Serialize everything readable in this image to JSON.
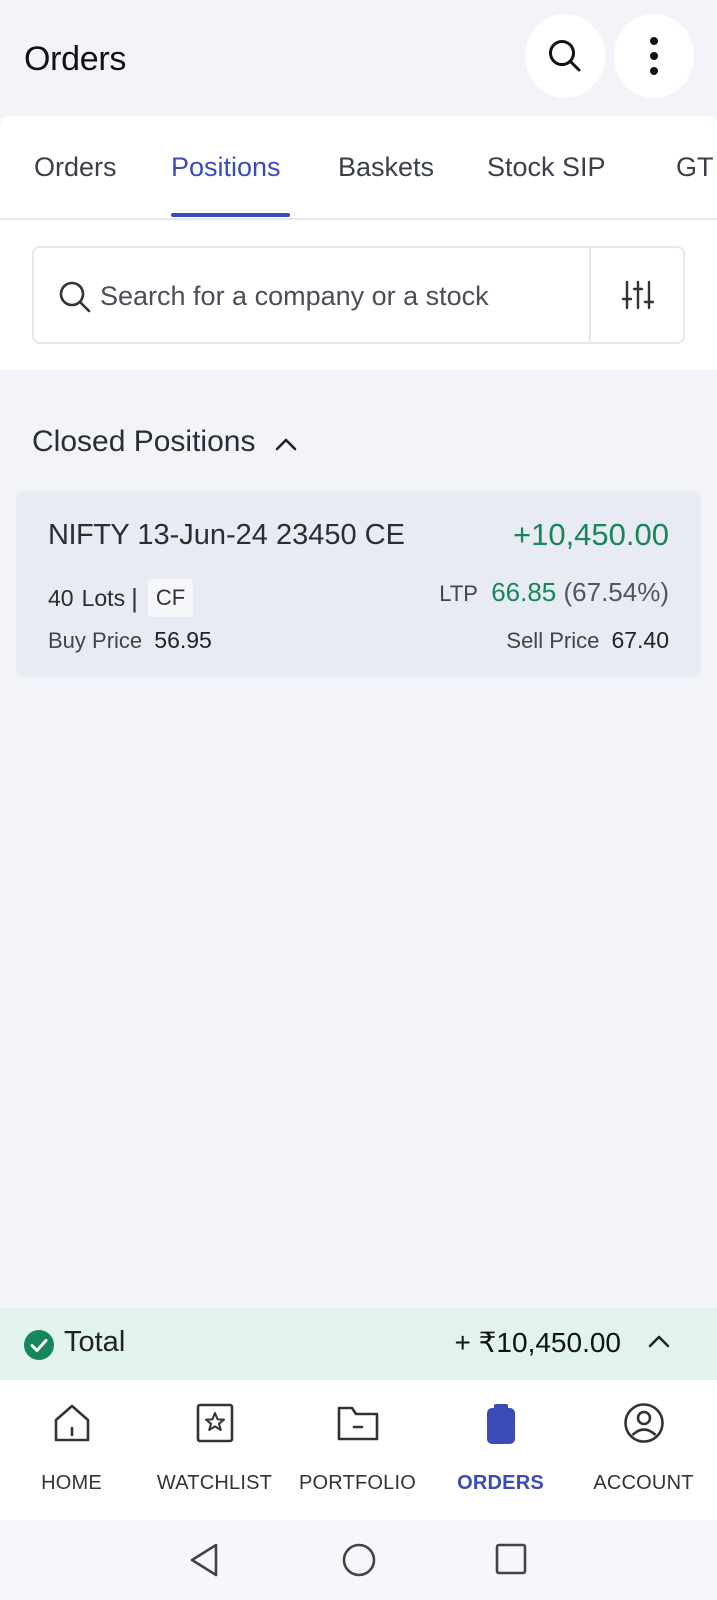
{
  "header": {
    "title": "Orders"
  },
  "tabs": [
    {
      "label": "Orders",
      "active": false
    },
    {
      "label": "Positions",
      "active": true
    },
    {
      "label": "Baskets",
      "active": false
    },
    {
      "label": "Stock SIP",
      "active": false
    },
    {
      "label": "GT",
      "active": false
    }
  ],
  "search": {
    "placeholder": "Search for a company or a stock"
  },
  "section": {
    "title": "Closed Positions"
  },
  "position": {
    "symbol": "NIFTY",
    "contract": "13-Jun-24 23450 CE",
    "pnl": "+10,450.00",
    "lots_qty": "40",
    "lots_label": "Lots",
    "lots_divider": "|",
    "product": "CF",
    "ltp_label": "LTP",
    "ltp_value": "66.85",
    "ltp_change": "(67.54%)",
    "buy_label": "Buy Price",
    "buy_value": "56.95",
    "sell_label": "Sell Price",
    "sell_value": "67.40"
  },
  "total": {
    "label": "Total",
    "value": "+ ₹10,450.00"
  },
  "bottom_nav": [
    {
      "label": "HOME",
      "icon": "home-icon",
      "active": false
    },
    {
      "label": "WATCHLIST",
      "icon": "watchlist-icon",
      "active": false
    },
    {
      "label": "PORTFOLIO",
      "icon": "portfolio-icon",
      "active": false
    },
    {
      "label": "ORDERS",
      "icon": "orders-icon",
      "active": true
    },
    {
      "label": "ACCOUNT",
      "icon": "account-icon",
      "active": false
    }
  ],
  "colors": {
    "accent": "#3b4cb8",
    "profit": "#16875a",
    "total_bg": "#e2f2ee",
    "page_bg": "#f2f4f9"
  }
}
